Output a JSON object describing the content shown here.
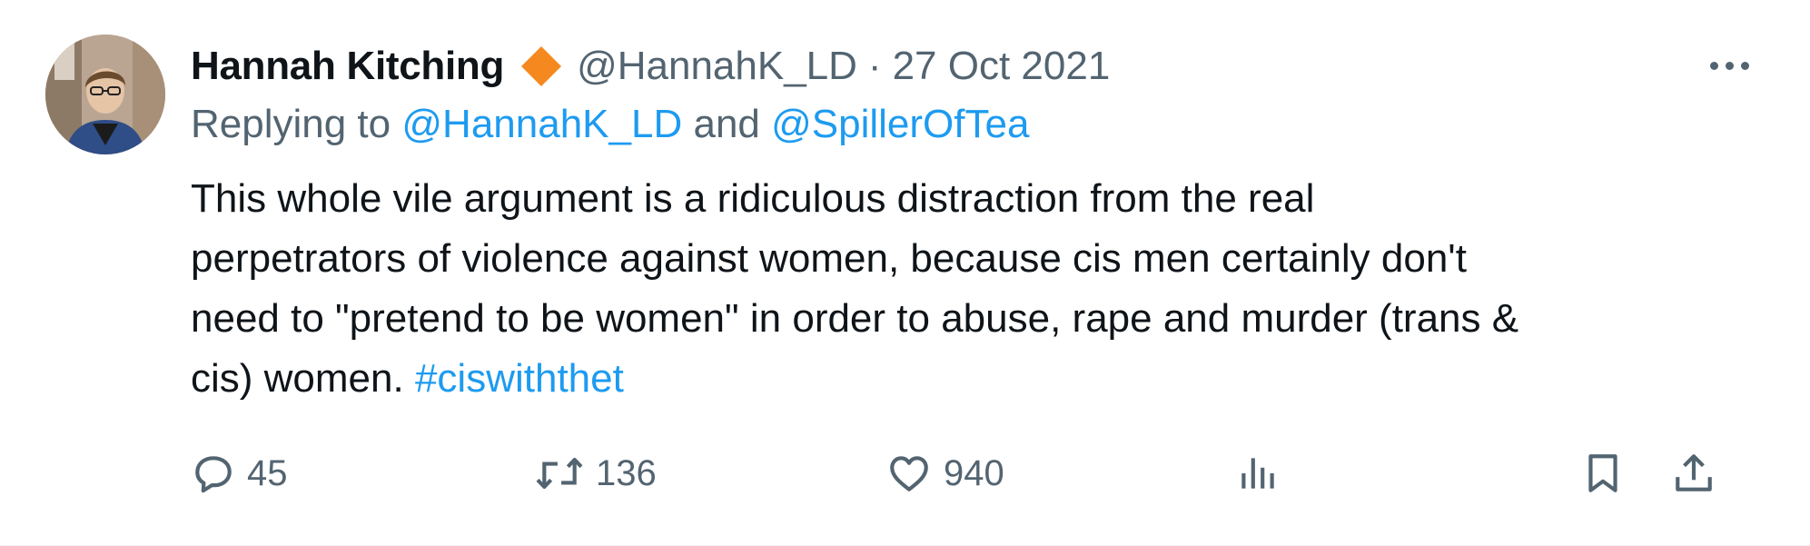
{
  "tweet": {
    "author_name": "Hannah Kitching",
    "handle": "@HannahK_LD",
    "separator": "·",
    "date": "27 Oct 2021",
    "reply_prefix": "Replying to",
    "reply_mention_1": "@HannahK_LD",
    "reply_and": "and",
    "reply_mention_2": "@SpillerOfTea",
    "body_lines": [
      "This whole vile argument is a ridiculous distraction from the real",
      "perpetrators of violence against women, because cis men certainly don't",
      "need to \"pretend to be women\" in order to abuse, rape and murder (trans &",
      "cis) women."
    ],
    "hashtag": "#ciswiththet",
    "badge_color": "#f5891f",
    "link_color": "#1d9bf0"
  },
  "actions": {
    "reply_count": "45",
    "retweet_count": "136",
    "like_count": "940"
  },
  "icons": {
    "badge": "diamond-badge-icon",
    "more": "more-options-icon",
    "reply": "reply-icon",
    "retweet": "retweet-icon",
    "like": "heart-icon",
    "views": "views-icon",
    "bookmark": "bookmark-icon",
    "share": "share-icon"
  }
}
